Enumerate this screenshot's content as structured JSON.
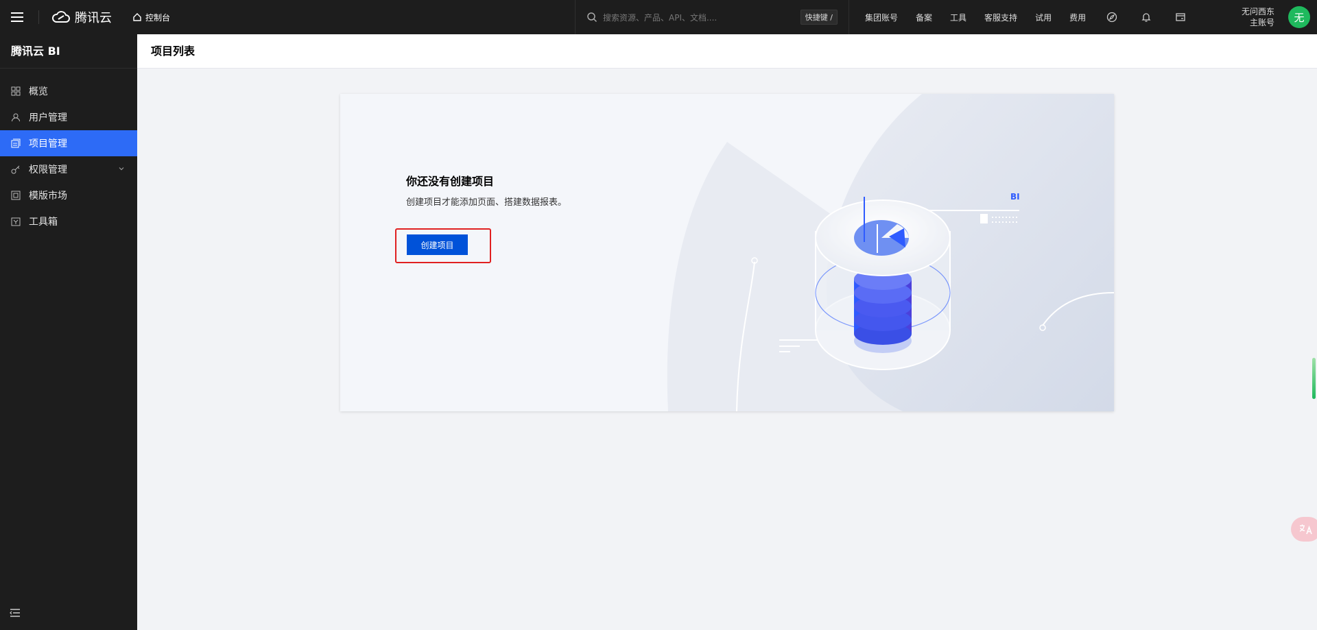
{
  "topbar": {
    "brand": "腾讯云",
    "console_label": "控制台",
    "search_placeholder": "搜索资源、产品、API、文档....",
    "shortcut_label": "快捷键 /",
    "nav": [
      "集团账号",
      "备案",
      "工具",
      "客服支持",
      "试用",
      "费用"
    ],
    "icons": [
      "compass-icon",
      "bell-icon",
      "cart-icon"
    ],
    "account_name": "无问西东",
    "account_role": "主账号",
    "avatar_text": "无"
  },
  "sidebar": {
    "title": "腾讯云 BI",
    "items": [
      {
        "label": "概览",
        "icon": "grid-icon"
      },
      {
        "label": "用户管理",
        "icon": "user-icon"
      },
      {
        "label": "项目管理",
        "icon": "project-icon"
      },
      {
        "label": "权限管理",
        "icon": "key-icon"
      },
      {
        "label": "模版市场",
        "icon": "template-icon"
      },
      {
        "label": "工具箱",
        "icon": "toolbox-icon"
      }
    ],
    "active_index": 2
  },
  "header": {
    "title": "项目列表"
  },
  "empty_state": {
    "title": "你还没有创建项目",
    "description": "创建项目才能添加页面、搭建数据报表。",
    "create_button": "创建项目",
    "illustration_label": "BI"
  },
  "colors": {
    "topbar_bg": "#1d1d1d",
    "active_menu": "#2d6bf6",
    "primary_button": "#0052d9",
    "highlight_box": "#e02020",
    "avatar": "#1fb95d"
  }
}
